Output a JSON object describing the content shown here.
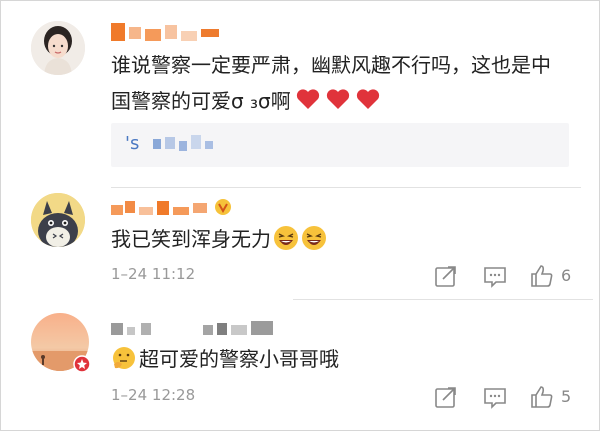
{
  "comments": [
    {
      "text_line1": "谁说警察一定要严肃，幽默风趣不行吗，这也是中",
      "text_line2": "国警察的可爱σ  ₃σ啊",
      "quote_prefix": "'s",
      "hearts": 3
    },
    {
      "text": "我已笑到浑身无力",
      "time": "1–24 11:12",
      "likes": "6"
    },
    {
      "text": "超可爱的警察小哥哥哦",
      "time": "1–24 12:28",
      "likes": "5"
    }
  ],
  "icons": {
    "share": "share-icon",
    "comment": "comment-icon",
    "like": "thumbs-up-icon"
  },
  "colors": {
    "heart": "#e0333b",
    "username_orange": "#f07a2a",
    "meta_gray": "#999999"
  }
}
